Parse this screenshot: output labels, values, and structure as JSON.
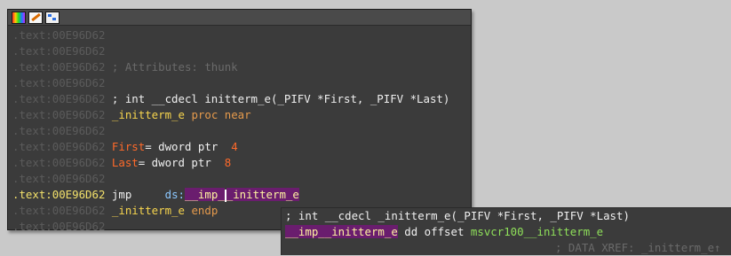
{
  "node": {
    "toolbar_icons": [
      "color-palette-icon",
      "edit-node-icon",
      "graph-icon"
    ],
    "lines": [
      {
        "addr": ".text:00E96D62"
      },
      {
        "addr": ".text:00E96D62"
      },
      {
        "addr": ".text:00E96D62",
        "comment": "; Attributes: thunk"
      },
      {
        "addr": ".text:00E96D62"
      },
      {
        "addr": ".text:00E96D62",
        "proto": "; int __cdecl initterm_e(_PIFV *First, _PIFV *Last)"
      },
      {
        "addr": ".text:00E96D62",
        "fname": "_initterm_e",
        "kw": "proc near"
      },
      {
        "addr": ".text:00E96D62"
      },
      {
        "addr": ".text:00E96D62",
        "var": "First",
        "type": "= dword ptr",
        "num": "4"
      },
      {
        "addr": ".text:00E96D62",
        "var": "Last",
        "type": "= dword ptr",
        "num": "8"
      },
      {
        "addr": ".text:00E96D62"
      },
      {
        "addr": ".text:00E96D62",
        "mnemonic": "jmp",
        "seg": "ds:",
        "target_a": "__imp_",
        "target_b": "_initterm_e"
      },
      {
        "addr": ".text:00E96D62",
        "fname": "_initterm_e",
        "kw": "endp"
      },
      {
        "addr": ".text:00E96D62"
      }
    ]
  },
  "hint": {
    "proto": "; int __cdecl _initterm_e(_PIFV *First, _PIFV *Last)",
    "symbol": "__imp__initterm_e",
    "directive": "dd offset",
    "target": "msvcr100__initterm_e",
    "xref": "; DATA XREF: _initterm_e↑"
  }
}
